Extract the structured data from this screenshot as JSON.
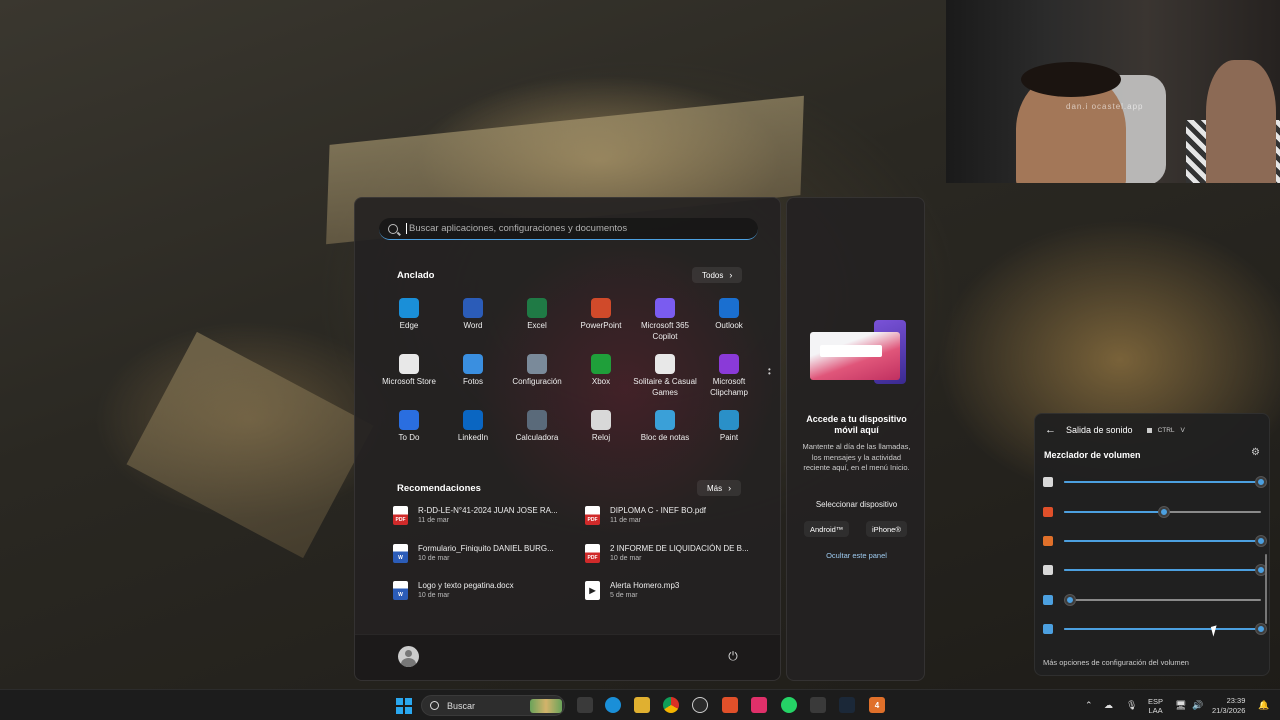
{
  "webcam": {
    "watermark": "dan.i ocastel.app"
  },
  "start_menu": {
    "search": {
      "placeholder": "Buscar aplicaciones, configuraciones y documentos"
    },
    "pinned": {
      "title": "Anclado",
      "all_label": "Todos",
      "apps": [
        {
          "label": "Edge",
          "icon": "edge-icon",
          "color": "#1a8fd8"
        },
        {
          "label": "Word",
          "icon": "word-icon",
          "color": "#2b5cb8"
        },
        {
          "label": "Excel",
          "icon": "excel-icon",
          "color": "#1f7a45"
        },
        {
          "label": "PowerPoint",
          "icon": "powerpoint-icon",
          "color": "#d04a2a"
        },
        {
          "label": "Microsoft 365 Copilot",
          "icon": "copilot-icon",
          "color": "#7a5cf0"
        },
        {
          "label": "Outlook",
          "icon": "outlook-icon",
          "color": "#1a6fd0"
        },
        {
          "label": "Microsoft Store",
          "icon": "store-icon",
          "color": "#e8e8e8"
        },
        {
          "label": "Fotos",
          "icon": "photos-icon",
          "color": "#3a8fe0"
        },
        {
          "label": "Configuración",
          "icon": "settings-icon",
          "color": "#7a8a9a"
        },
        {
          "label": "Xbox",
          "icon": "xbox-icon",
          "color": "#1f9f3a"
        },
        {
          "label": "Solitaire & Casual Games",
          "icon": "solitaire-icon",
          "color": "#e8e8e8"
        },
        {
          "label": "Microsoft Clipchamp",
          "icon": "clipchamp-icon",
          "color": "#8a3ad8"
        },
        {
          "label": "To Do",
          "icon": "todo-icon",
          "color": "#2a6ee0"
        },
        {
          "label": "LinkedIn",
          "icon": "linkedin-icon",
          "color": "#0a66c2"
        },
        {
          "label": "Calculadora",
          "icon": "calculator-icon",
          "color": "#5a6a7a"
        },
        {
          "label": "Reloj",
          "icon": "clock-icon",
          "color": "#d8d8d8"
        },
        {
          "label": "Bloc de notas",
          "icon": "notepad-icon",
          "color": "#3aa0d8"
        },
        {
          "label": "Paint",
          "icon": "paint-icon",
          "color": "#2a90c8"
        }
      ]
    },
    "recommended": {
      "title": "Recomendaciones",
      "more_label": "Más",
      "items": [
        {
          "name": "R-DD-LE-N°41-2024 JUAN JOSE RA...",
          "date": "11 de mar",
          "type": "pdf"
        },
        {
          "name": "DIPLOMA C - INEF BO.pdf",
          "date": "11 de mar",
          "type": "pdf"
        },
        {
          "name": "Formulario_Finiquito DANIEL BURG...",
          "date": "10 de mar",
          "type": "doc"
        },
        {
          "name": "2 INFORME DE LIQUIDACIÓN DE B...",
          "date": "10 de mar",
          "type": "pdf"
        },
        {
          "name": "Logo y texto pegatina.docx",
          "date": "10 de mar",
          "type": "doc"
        },
        {
          "name": "Alerta Homero.mp3",
          "date": "5 de mar",
          "type": "mp3"
        }
      ]
    }
  },
  "phone_panel": {
    "title": "Accede a tu dispositivo móvil aquí",
    "description": "Mantente al día de las llamadas, los mensajes y la actividad reciente aquí, en el menú Inicio.",
    "select_label": "Seleccionar dispositivo",
    "android_label": "Android™",
    "iphone_label": "iPhone®",
    "hide_label": "Ocultar este panel"
  },
  "volume_mixer": {
    "header": "Salida de sonido",
    "shortcut": [
      "CTRL",
      "V"
    ],
    "title": "Mezclador de volumen",
    "rows": [
      {
        "app": "app-1-icon",
        "level": 1.0,
        "color": "#d8d8d8"
      },
      {
        "app": "brave-icon",
        "level": 0.51,
        "color": "#e0502a"
      },
      {
        "app": "app-4-icon",
        "level": 1.0,
        "color": "#e0702a"
      },
      {
        "app": "steam-icon",
        "level": 1.0,
        "color": "#d8d8d8"
      },
      {
        "app": "app-check-icon",
        "level": 0.03,
        "color": "#4ca0e0"
      },
      {
        "app": "app-check2-icon",
        "level": 1.0,
        "color": "#4ca0e0"
      }
    ],
    "more_label": "Más opciones de configuración del volumen"
  },
  "taskbar": {
    "search_label": "Buscar",
    "language": [
      "ESP",
      "LAA"
    ],
    "time": "23:39",
    "date": "21/3/2026"
  }
}
